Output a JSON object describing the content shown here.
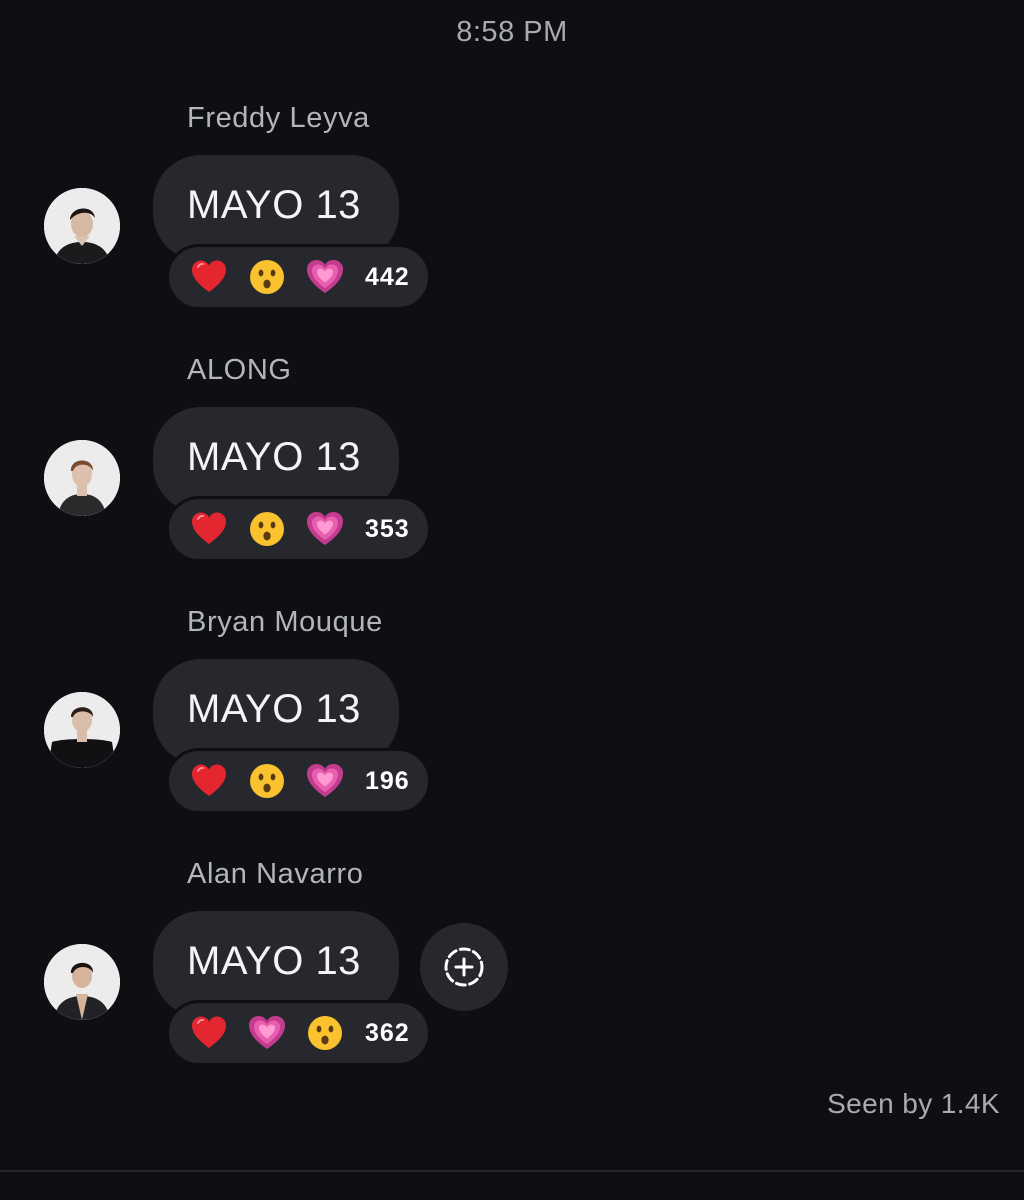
{
  "header": {
    "time": "8:58 PM"
  },
  "messages": [
    {
      "sender": "Freddy Leyva",
      "text": "MAYO 13",
      "reactions": [
        "red-heart",
        "surprised-face",
        "growing-heart"
      ],
      "reaction_count": "442"
    },
    {
      "sender": "ALONG",
      "text": "MAYO 13",
      "reactions": [
        "red-heart",
        "surprised-face",
        "growing-heart"
      ],
      "reaction_count": "353"
    },
    {
      "sender": "Bryan Mouque",
      "text": "MAYO 13",
      "reactions": [
        "red-heart",
        "surprised-face",
        "growing-heart"
      ],
      "reaction_count": "196"
    },
    {
      "sender": "Alan Navarro",
      "text": "MAYO 13",
      "reactions": [
        "red-heart",
        "growing-heart",
        "surprised-face"
      ],
      "reaction_count": "362"
    }
  ],
  "add_reaction": {
    "icon": "add-reaction-icon"
  },
  "footer": {
    "seen_by": "Seen by 1.4K"
  },
  "colors": {
    "background": "#0d0f13",
    "bubble": "#26282d",
    "muted_text": "#a8aab0",
    "heart": "#e3262f",
    "pink_heart": "#e95fb0",
    "emoji_face": "#f9c22e"
  }
}
